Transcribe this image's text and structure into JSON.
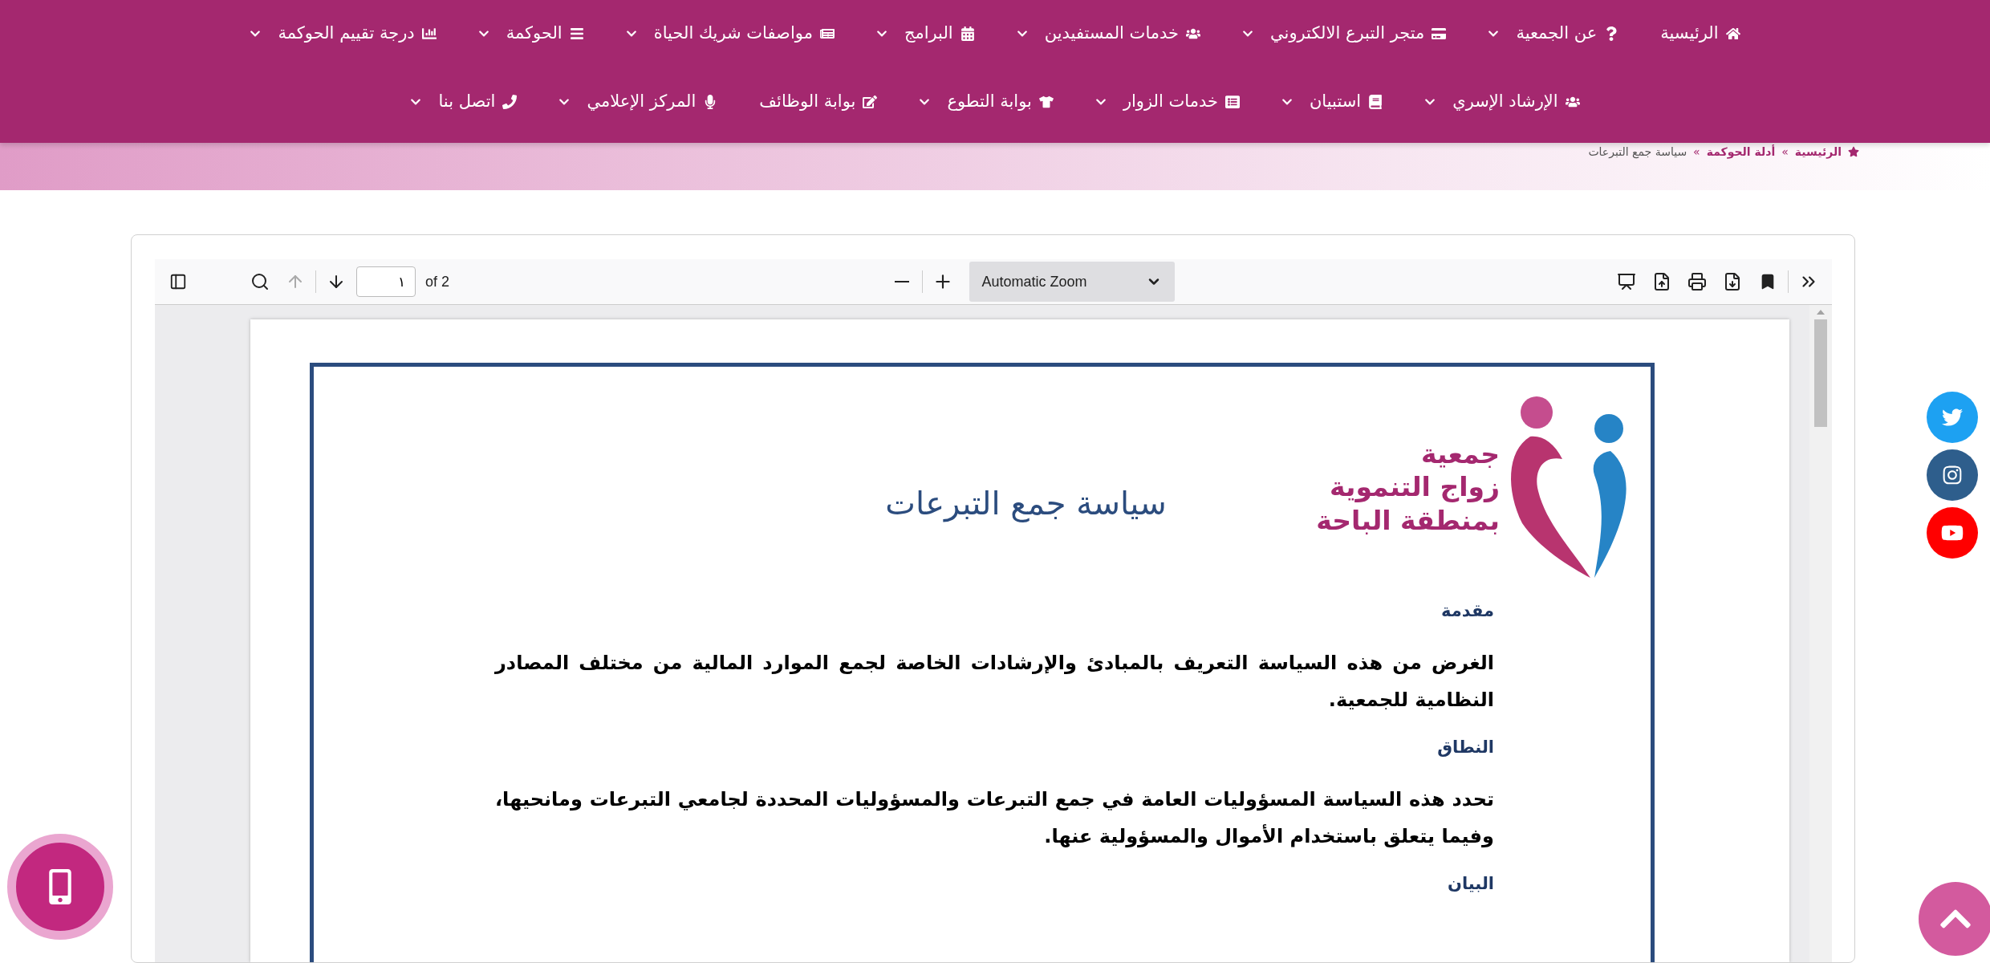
{
  "nav": {
    "items": [
      {
        "label": "الرئيسية",
        "has_menu": false
      },
      {
        "label": "عن الجمعية",
        "has_menu": true
      },
      {
        "label": "متجر التبرع الالكتروني",
        "has_menu": true
      },
      {
        "label": "خدمات المستفيدين",
        "has_menu": true
      },
      {
        "label": "البرامج",
        "has_menu": true
      },
      {
        "label": "مواصفات شريك الحياة",
        "has_menu": true
      },
      {
        "label": "الحوكمة",
        "has_menu": true
      },
      {
        "label": "درجة تقييم الحوكمة",
        "has_menu": true
      },
      {
        "label": "الإرشاد الإسري",
        "has_menu": true
      },
      {
        "label": "استبيان",
        "has_menu": true
      },
      {
        "label": "خدمات الزوار",
        "has_menu": true
      },
      {
        "label": "بوابة التطوع",
        "has_menu": true
      },
      {
        "label": "بوابة الوظائف",
        "has_menu": false
      },
      {
        "label": "المركز الإعلامي",
        "has_menu": true
      },
      {
        "label": "اتصل بنا",
        "has_menu": true
      }
    ]
  },
  "breadcrumb": {
    "separator": "»",
    "items": [
      "الرئيسية",
      "أدلة الحوكمة",
      "سياسة جمع التبرعات"
    ]
  },
  "pdf_viewer": {
    "page_input": "١",
    "page_count": "of 2",
    "zoom": "Automatic Zoom",
    "previous_disabled": true,
    "document": {
      "title": "سياسة جمع التبرعات",
      "logo_lines": [
        "جمعية",
        "زواج التنموية",
        "بمنطقة الباحة"
      ],
      "sections": [
        {
          "heading": "مقدمة",
          "body": "الغرض من هذه السياسة التعريف بالمبادئ والإرشادات الخاصة لجمع الموارد المالية من مختلف المصادر النظامية للجمعية."
        },
        {
          "heading": "النطاق",
          "body": "تحدد هذه السياسة المسؤوليات العامة في جمع التبرعات والمسؤوليات المحددة لجامعي التبرعات ومانحيها، وفيما يتعلق باستخدام الأموال والمسؤولية عنها."
        },
        {
          "heading": "البيان"
        }
      ]
    }
  }
}
